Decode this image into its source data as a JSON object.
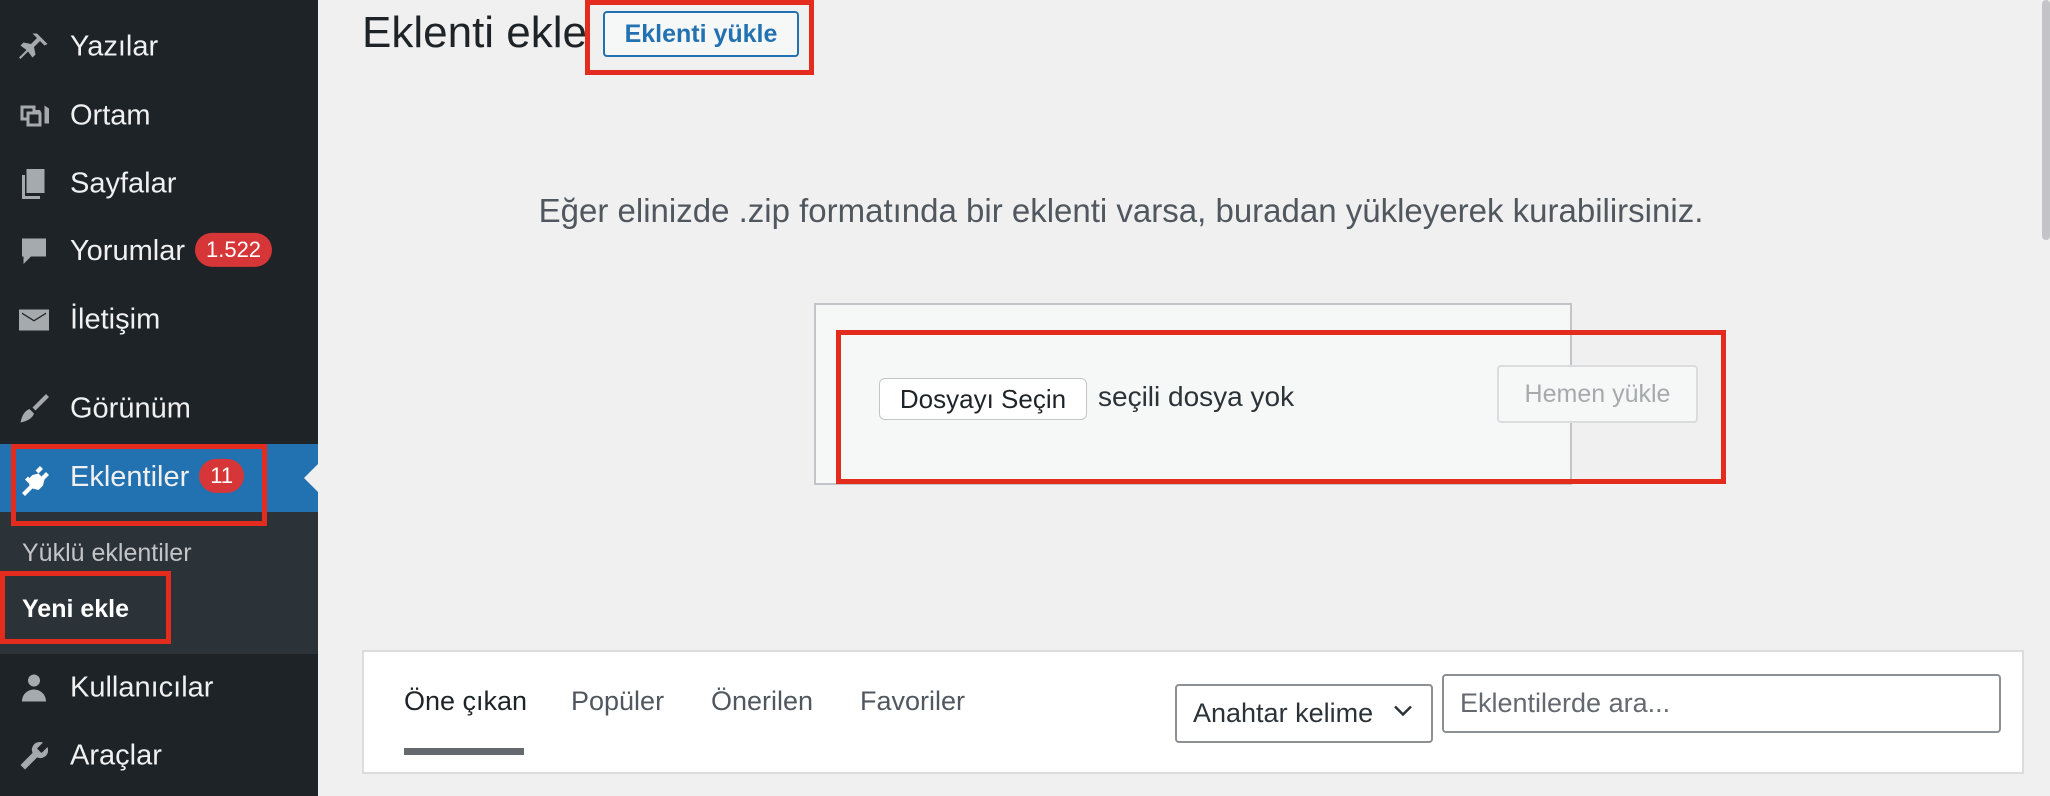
{
  "sidebar": {
    "items": [
      {
        "label": "Yazılar",
        "icon": "pin-icon"
      },
      {
        "label": "Ortam",
        "icon": "media-icon"
      },
      {
        "label": "Sayfalar",
        "icon": "pages-icon"
      },
      {
        "label": "Yorumlar",
        "icon": "comment-icon",
        "badge": "1.522"
      },
      {
        "label": "İletişim",
        "icon": "mail-icon"
      },
      {
        "label": "Görünüm",
        "icon": "brush-icon"
      },
      {
        "label": "Eklentiler",
        "icon": "plugin-icon",
        "badge": "11",
        "active": true
      },
      {
        "label": "Kullanıcılar",
        "icon": "user-icon"
      },
      {
        "label": "Araçlar",
        "icon": "wrench-icon"
      }
    ],
    "submenu": [
      {
        "label": "Yüklü eklentiler"
      },
      {
        "label": "Yeni ekle",
        "current": true
      }
    ]
  },
  "header": {
    "title": "Eklenti ekle",
    "upload_button": "Eklenti yükle"
  },
  "upload": {
    "help_text": "Eğer elinizde .zip formatında bir eklenti varsa, buradan yükleyerek kurabilirsiniz.",
    "choose_file_label": "Dosyayı Seçin",
    "no_file_text": "seçili dosya yok",
    "install_button": "Hemen yükle"
  },
  "filter": {
    "tabs": [
      {
        "label": "Öne çıkan",
        "current": true
      },
      {
        "label": "Popüler"
      },
      {
        "label": "Önerilen"
      },
      {
        "label": "Favoriler"
      }
    ],
    "search_type": "Anahtar kelime",
    "search_placeholder": "Eklentilerde ara..."
  },
  "colors": {
    "sidebar_bg": "#1d2327",
    "active_bg": "#2271b1",
    "badge_bg": "#d63638",
    "highlight": "#e32c1e"
  }
}
